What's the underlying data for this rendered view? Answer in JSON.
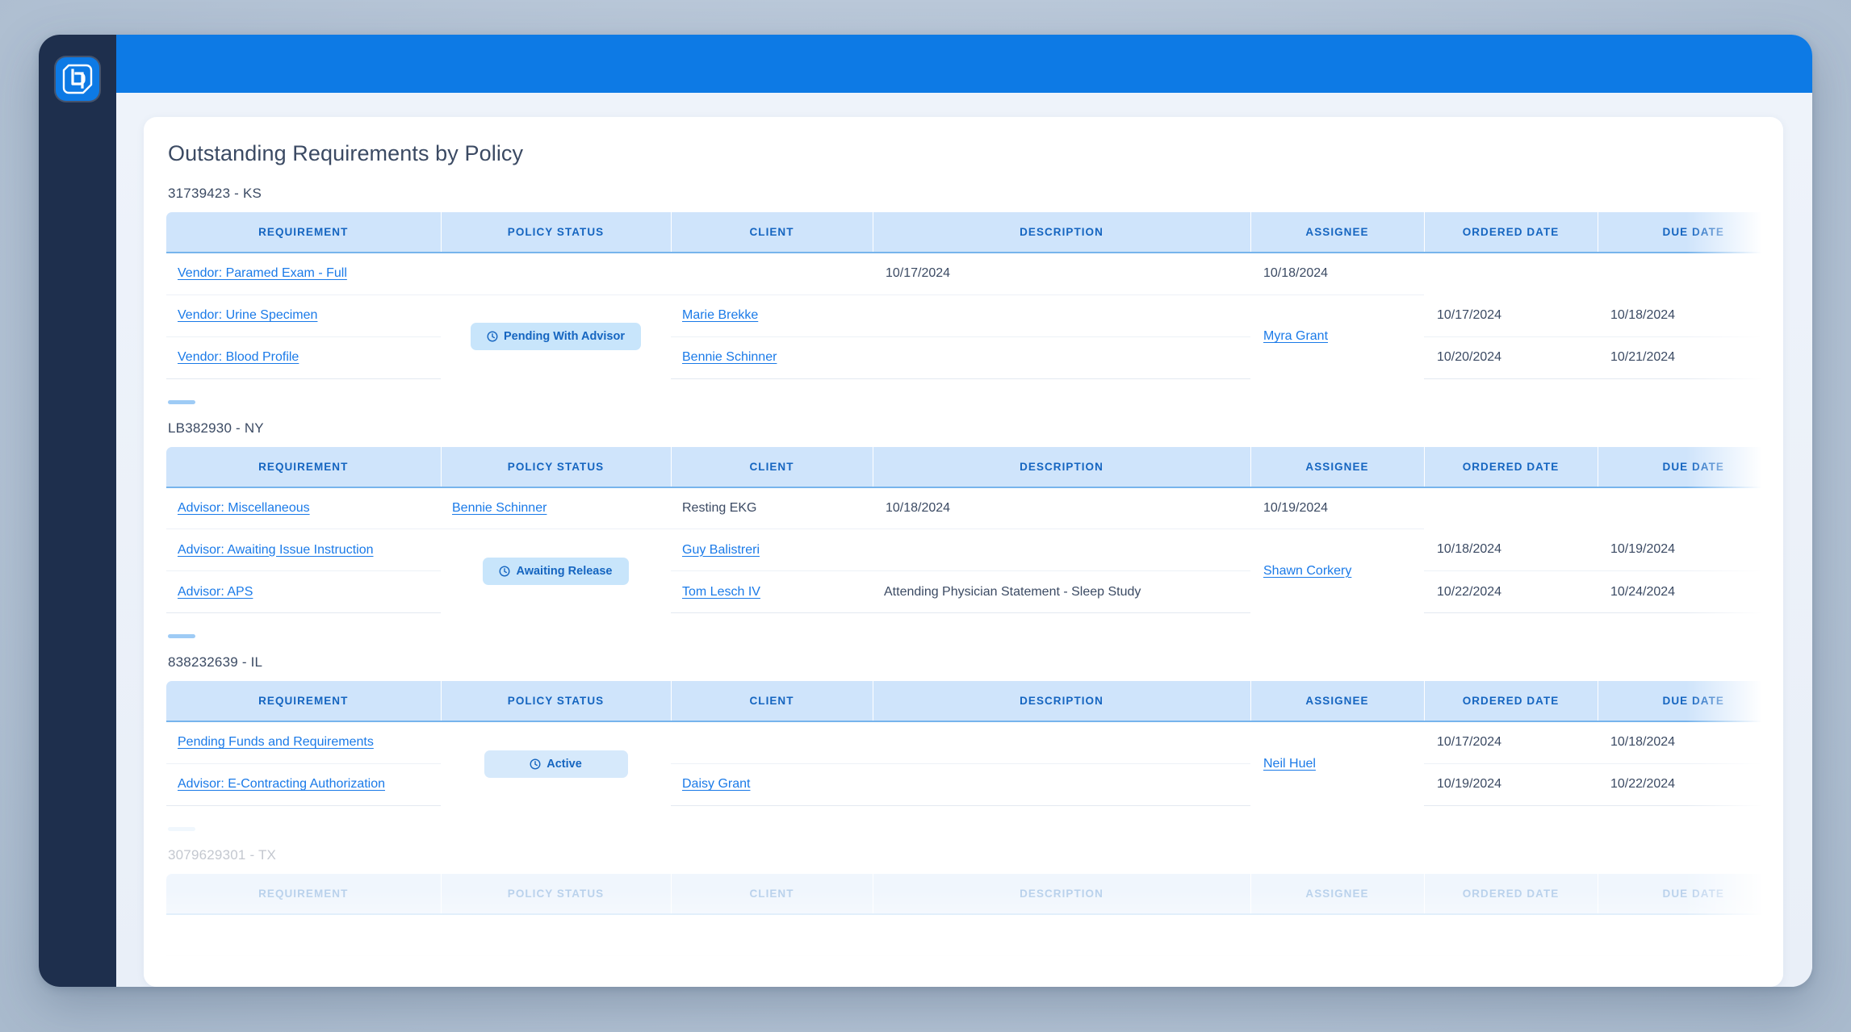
{
  "app": {
    "logo_name": "brand-logo",
    "brand_color": "#0d7ae5",
    "sidebar_color": "#1e2f4d",
    "accent_color": "#1a7ae8",
    "header_bg_color": "#cfe4fb",
    "pill_bg_color": "#c8e5fb"
  },
  "card": {
    "title": "Outstanding Requirements by Policy"
  },
  "columns": [
    "REQUIREMENT",
    "POLICY STATUS",
    "CLIENT",
    "DESCRIPTION",
    "ASSIGNEE",
    "ORDERED DATE",
    "DUE DATE"
  ],
  "groups": [
    {
      "label": "31739423 - KS",
      "status": "Pending With Advisor",
      "status_icon": "clock-icon",
      "assignee": "Myra Grant",
      "rows": [
        {
          "requirement": "Vendor: Paramed Exam -  Full",
          "client": "",
          "description": "",
          "ordered_date": "10/17/2024",
          "due_date": "10/18/2024"
        },
        {
          "requirement": "Vendor: Urine Specimen",
          "client": "Marie Brekke",
          "description": "",
          "ordered_date": "10/17/2024",
          "due_date": "10/18/2024"
        },
        {
          "requirement": "Vendor: Blood Profile",
          "client": "Bennie Schinner",
          "description": "",
          "ordered_date": "10/20/2024",
          "due_date": "10/21/2024"
        }
      ]
    },
    {
      "label": "LB382930 - NY",
      "status": "Awaiting Release",
      "status_icon": "clock-icon",
      "assignee": "Shawn Corkery",
      "rows": [
        {
          "requirement": "Advisor: Miscellaneous",
          "client": "Bennie Schinner",
          "description": "Resting EKG",
          "ordered_date": "10/18/2024",
          "due_date": "10/19/2024"
        },
        {
          "requirement": "Advisor: Awaiting Issue Instruction",
          "client": "Guy Balistreri",
          "description": "",
          "ordered_date": "10/18/2024",
          "due_date": "10/19/2024"
        },
        {
          "requirement": "Advisor: APS",
          "client": "Tom Lesch IV",
          "description": "Attending Physician Statement - Sleep Study",
          "ordered_date": "10/22/2024",
          "due_date": "10/24/2024"
        }
      ]
    },
    {
      "label": "838232639 - IL",
      "status": "Active",
      "status_icon": "clock-icon",
      "assignee": "Neil Huel",
      "rows": [
        {
          "requirement": "Pending Funds and Requirements",
          "client": "",
          "description": "",
          "ordered_date": "10/17/2024",
          "due_date": "10/18/2024"
        },
        {
          "requirement": "Advisor: E-Contracting Authorization",
          "client": "Daisy Grant",
          "description": "",
          "ordered_date": "10/19/2024",
          "due_date": "10/22/2024"
        }
      ]
    },
    {
      "label": "3079629301 - TX",
      "status": "",
      "status_icon": "",
      "assignee": "",
      "rows": []
    }
  ],
  "group_client_overrides": {
    "0": {
      "1": "Marie Brekke"
    }
  }
}
